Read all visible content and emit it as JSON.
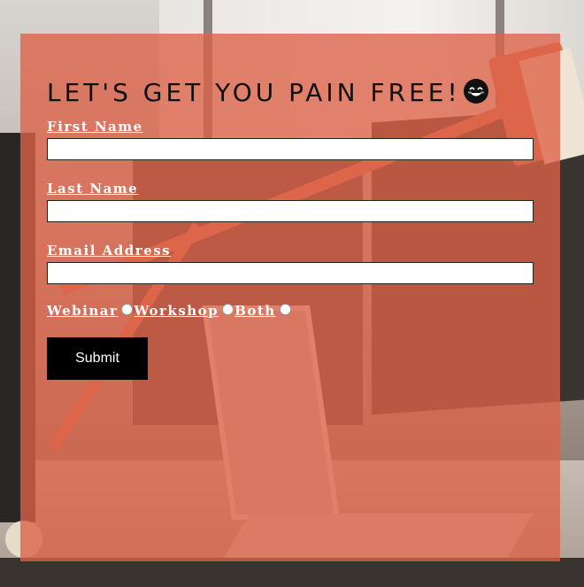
{
  "form": {
    "title": "LET'S GET YOU PAIN FREE!",
    "title_emoji": "smiling-face-emoji",
    "fields": [
      {
        "label": "First Name",
        "value": ""
      },
      {
        "label": "Last Name",
        "value": ""
      },
      {
        "label": "Email Address",
        "value": ""
      }
    ],
    "options": [
      {
        "label": "Webinar",
        "selected": false
      },
      {
        "label": "Workshop",
        "selected": false
      },
      {
        "label": "Both",
        "selected": false
      }
    ],
    "submit_label": "Submit"
  },
  "colors": {
    "panel_overlay": "#dc6248",
    "label_text": "#ffffff",
    "title_text": "#111111",
    "button_bg": "#000000",
    "button_text": "#ffffff"
  }
}
